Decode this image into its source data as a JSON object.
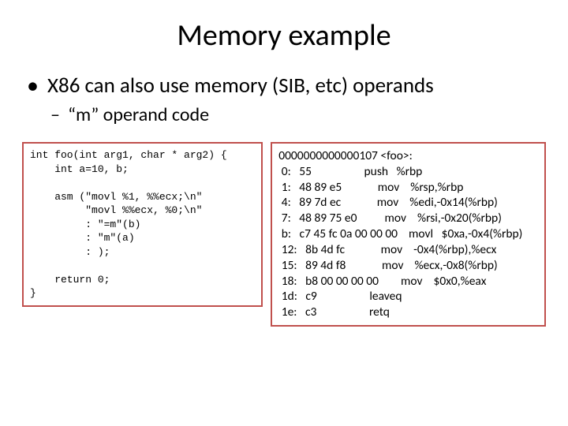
{
  "title": "Memory example",
  "bullets": {
    "b1": "X86 can also use memory (SIB, etc) operands",
    "b2": "“m” operand code"
  },
  "source_code": "int foo(int arg1, char * arg2) {\n    int a=10, b;\n\n    asm (\"movl %1, %%ecx;\\n\"\n         \"movl %%ecx, %0;\\n\"\n         : \"=m\"(b)\n         : \"m\"(a)\n         : );\n\n    return 0;\n}",
  "disassembly": "0000000000000107 <foo>:\n 0:   55                   push   %rbp\n 1:   48 89 e5             mov    %rsp,%rbp\n 4:   89 7d ec             mov    %edi,-0x14(%rbp)\n 7:   48 89 75 e0          mov    %rsi,-0x20(%rbp)\n b:   c7 45 fc 0a 00 00 00    movl   $0xa,-0x4(%rbp)\n 12:   8b 4d fc             mov    -0x4(%rbp),%ecx\n 15:   89 4d f8             mov    %ecx,-0x8(%rbp)\n 18:   b8 00 00 00 00        mov    $0x0,%eax\n 1d:   c9                   leaveq\n 1e:   c3                   retq"
}
